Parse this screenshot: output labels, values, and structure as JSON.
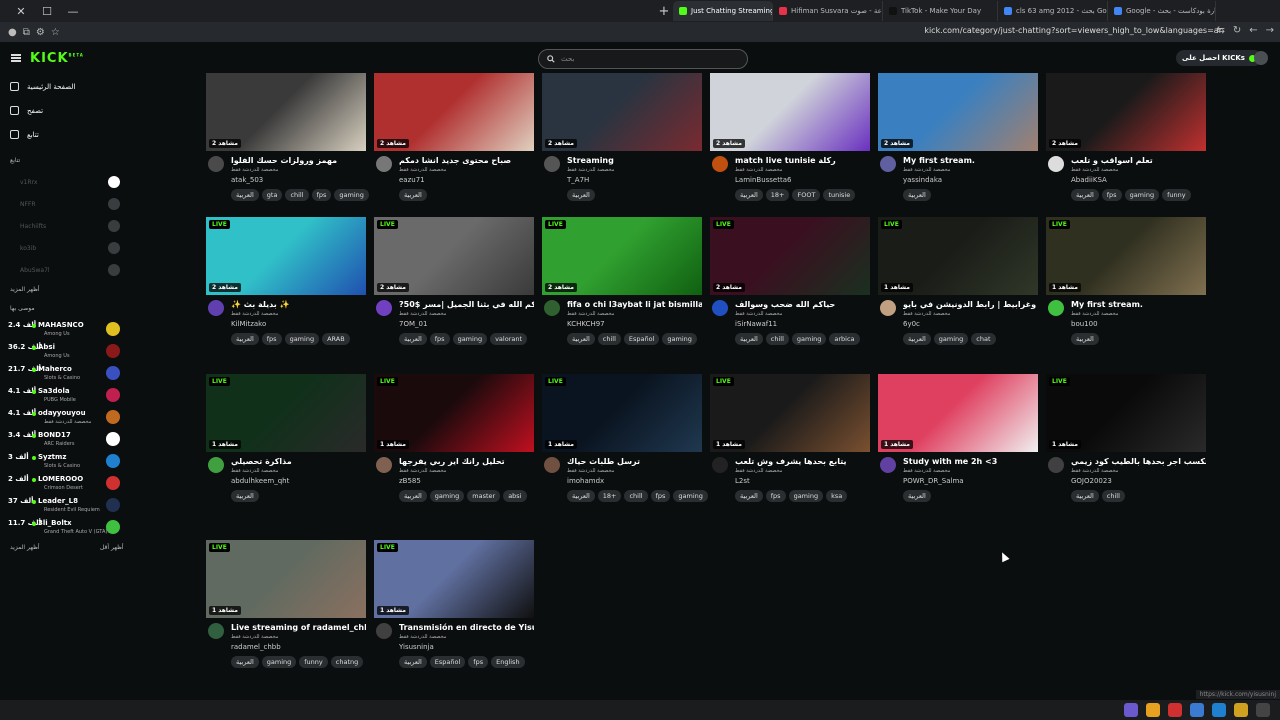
{
  "browser": {
    "tabs": [
      {
        "label": "Just Chatting Streaming - Live",
        "active": true,
        "color": "#53fc18"
      },
      {
        "label": "Hifiman Susvara سماعة - صوت",
        "active": false,
        "color": "#e8324a"
      },
      {
        "label": "TikTok - Make Your Day",
        "active": false,
        "color": "#111111"
      },
      {
        "label": "cls 63 amg 2012 - بحث Google",
        "active": false,
        "color": "#4285f4"
      },
      {
        "label": "Google - سيارة بودكاست - بحث",
        "active": false,
        "color": "#4285f4"
      }
    ],
    "url": "kick.com/category/just-chatting?sort=viewers_high_to_low&languages=ar"
  },
  "header": {
    "logo": "KICK",
    "logo_sup": "BETA",
    "search_placeholder": "بحث",
    "get_kicks": "احصل على KICKs"
  },
  "sidebar": {
    "nav": [
      {
        "label": "الصفحة الرئيسية",
        "icon": "home-icon"
      },
      {
        "label": "تصفح",
        "icon": "browse-icon"
      },
      {
        "label": "تتابع",
        "icon": "heart-icon"
      }
    ],
    "following_title": "تتابع",
    "following": [
      {
        "name": "v1Rrx"
      },
      {
        "name": "NFFR"
      },
      {
        "name": "Hachiifts"
      },
      {
        "name": "ko3ib"
      },
      {
        "name": "AbuSwa7l"
      }
    ],
    "show_more": "أظهر المزيد",
    "recommended_title": "موصى بها",
    "recommended": [
      {
        "name": "MAHASNCO",
        "game": "Among Us",
        "viewers": "2.4 ألف",
        "color": "#e0c020"
      },
      {
        "name": "Absi",
        "game": "Among Us",
        "viewers": "36.2 ألف",
        "color": "#8a1a1a"
      },
      {
        "name": "Maherco",
        "game": "Slots & Casino",
        "viewers": "21.7 ألف",
        "color": "#3a50c0"
      },
      {
        "name": "Sa3dola",
        "game": "PUBG Mobile",
        "viewers": "4.1 ألف",
        "color": "#c02050"
      },
      {
        "name": "odayyouyou",
        "game": "مخصصة للدردشة فقط",
        "viewers": "4.1 ألف",
        "color": "#c06a20"
      },
      {
        "name": "BOND17",
        "game": "ARC Raiders",
        "viewers": "3.4 ألف",
        "color": "#ffffff"
      },
      {
        "name": "Syztmz",
        "game": "Slots & Casino",
        "viewers": "3 ألف",
        "color": "#2080d0"
      },
      {
        "name": "LOMEROOO",
        "game": "Crimson Desert",
        "viewers": "2 ألف",
        "color": "#d03030"
      },
      {
        "name": "Leader_L8",
        "game": "Resident Evil Requiem",
        "viewers": "37 ألف",
        "color": "#203050"
      },
      {
        "name": "3li_Boltx",
        "game": "Grand Theft Auto V (GTA)...",
        "viewers": "11.7 ألف",
        "color": "#40c040"
      }
    ],
    "show_more2": "أظهر المزيد",
    "show_less": "أظهر أقل"
  },
  "cards": [
    {
      "title": "مهمز ورولزات حسك الفلوا",
      "sub": "مخصصة للدردشة فقط",
      "user": "atak_503",
      "viewers": "2 مشاهد",
      "live": false,
      "tags": [
        "العربية",
        "gta",
        "chill",
        "fps",
        "gaming"
      ],
      "thumb": "#3a3a3a",
      "thumb2": "#d8d0c0",
      "av": "#4a4a4a"
    },
    {
      "title": "صباح محتوى جديد انشا دمكم",
      "sub": "مخصصة للدردشة فقط",
      "user": "eazu71",
      "viewers": "2 مشاهد",
      "live": false,
      "tags": [
        "العربية"
      ],
      "thumb": "#b03030",
      "thumb2": "#e0d0c0",
      "av": "#777777"
    },
    {
      "title": "Streaming",
      "sub": "مخصصة للدردشة فقط",
      "user": "T_A7H",
      "viewers": "2 مشاهد",
      "live": false,
      "tags": [
        "العربية"
      ],
      "thumb": "#2a3440",
      "thumb2": "#7a2a30",
      "av": "#555555"
    },
    {
      "title": "match live tunisie ركلة",
      "sub": "مخصصة للدردشة فقط",
      "user": "LaminBussetta6",
      "viewers": "2 مشاهد",
      "live": false,
      "tags": [
        "العربية",
        "18+",
        "FOOT",
        "tunisie"
      ],
      "thumb": "#d0d4da",
      "thumb2": "#6a30c0",
      "av": "#c05010"
    },
    {
      "title": "My first stream.",
      "sub": "مخصصة للدردشة فقط",
      "user": "yassindaka",
      "viewers": "2 مشاهد",
      "live": false,
      "tags": [
        "العربية"
      ],
      "thumb": "#3a80c0",
      "thumb2": "#a08070",
      "av": "#6060a0"
    },
    {
      "title": "تعلم اسواقب و تلعب",
      "sub": "مخصصة للدردشة فقط",
      "user": "AbadiiKSA",
      "viewers": "2 مشاهد",
      "live": false,
      "tags": [
        "العربية",
        "fps",
        "gaming",
        "funny"
      ],
      "thumb": "#1a1a1a",
      "thumb2": "#c03030",
      "av": "#dddddd"
    },
    {
      "title": "✨ بديلة بث ✨",
      "sub": "مخصصة للدردشة فقط",
      "user": "KilMitzako",
      "viewers": "2 مشاهد",
      "live": true,
      "tags": [
        "العربية",
        "fps",
        "gaming",
        "ARAB"
      ],
      "thumb": "#30c0c8",
      "thumb2": "#2050b0",
      "av": "#6040b0"
    },
    {
      "title": "?50$ حياكم الله في بثنا الجميل |مسر",
      "sub": "مخصصة للدردشة فقط",
      "user": "7OM_01",
      "viewers": "2 مشاهد",
      "live": true,
      "tags": [
        "العربية",
        "fps",
        "gaming",
        "valorant"
      ],
      "thumb": "#6a6a6a",
      "thumb2": "#3a3a3a",
      "av": "#7040c0"
    },
    {
      "title": "fifa o chi l3aybat li jat bismillah",
      "sub": "مخصصة للدردشة فقط",
      "user": "KCHKCH97",
      "viewers": "2 مشاهد",
      "live": true,
      "tags": [
        "العربية",
        "chill",
        "Español",
        "gaming"
      ],
      "thumb": "#30a030",
      "thumb2": "#106010",
      "av": "#306030"
    },
    {
      "title": "حياكم الله ضحب وسوالف",
      "sub": "مخصصة للدردشة فقط",
      "user": "iSirNawaf11",
      "viewers": "2 مشاهد",
      "live": true,
      "tags": [
        "العربية",
        "chill",
        "gaming",
        "arbica"
      ],
      "thumb": "#3a1020",
      "thumb2": "#1a3020",
      "av": "#2050c0"
    },
    {
      "title": "بث تختيم وغرابيط | رابط الدونيشن في بايو",
      "sub": "مخصصة للدردشة فقط",
      "user": "6y0c",
      "viewers": "1 مشاهد",
      "live": true,
      "tags": [
        "العربية",
        "gaming",
        "chat"
      ],
      "thumb": "#1a1c18",
      "thumb2": "#303828",
      "av": "#c0a080"
    },
    {
      "title": "My first stream.",
      "sub": "مخصصة للدردشة فقط",
      "user": "bou100",
      "viewers": "1 مشاهد",
      "live": true,
      "tags": [
        "العربية"
      ],
      "thumb": "#303020",
      "thumb2": "#807050",
      "av": "#40c040"
    },
    {
      "title": "مذاكرة تحصيلي",
      "sub": "مخصصة للدردشة فقط",
      "user": "abdulhkeem_qht",
      "viewers": "1 مشاهد",
      "live": true,
      "tags": [
        "العربية"
      ],
      "thumb": "#10301a",
      "thumb2": "#2a2a2a",
      "av": "#40a040"
    },
    {
      "title": "تحليل رانك اير ربي يفرجها",
      "sub": "مخصصة للدردشة فقط",
      "user": "zB585",
      "viewers": "1 مشاهد",
      "live": true,
      "tags": [
        "العربية",
        "gaming",
        "master",
        "absi"
      ],
      "thumb": "#1a0a0c",
      "thumb2": "#c01020",
      "av": "#806050"
    },
    {
      "title": "ترسل طلبات حياك",
      "sub": "مخصصة للدردشة فقط",
      "user": "imohamdx",
      "viewers": "1 مشاهد",
      "live": true,
      "tags": [
        "العربية",
        "18+",
        "chill",
        "fps",
        "gaming"
      ],
      "thumb": "#0a1420",
      "thumb2": "#203850",
      "av": "#705040"
    },
    {
      "title": "يتابع بحدها يشرف وش تلعب",
      "sub": "مخصصة للدردشة فقط",
      "user": "L2st",
      "viewers": "1 مشاهد",
      "live": true,
      "tags": [
        "العربية",
        "fps",
        "gaming",
        "ksa"
      ],
      "thumb": "#1a1a1a",
      "thumb2": "#7a5030",
      "av": "#222222"
    },
    {
      "title": "Study with me 2h <3",
      "sub": "مخصصة للدردشة فقط",
      "user": "POWR_DR_Salma",
      "viewers": "1 مشاهد",
      "live": false,
      "tags": [
        "العربية"
      ],
      "thumb": "#e04060",
      "thumb2": "#f0f0f0",
      "av": "#6040a0"
    },
    {
      "title": "القران تكسب اجر بحدها بالطيب كود زيمي",
      "sub": "مخصصة للدردشة فقط",
      "user": "GOJO20023",
      "viewers": "1 مشاهد",
      "live": true,
      "tags": [
        "العربية",
        "chill"
      ],
      "thumb": "#0a0a0a",
      "thumb2": "#2a2a2a",
      "av": "#404040"
    },
    {
      "title": "Live streaming of radamel_chbb",
      "sub": "مخصصة للدردشة فقط",
      "user": "radamel_chbb",
      "viewers": "1 مشاهد",
      "live": true,
      "tags": [
        "العربية",
        "gaming",
        "funny",
        "chatng"
      ],
      "thumb": "#606a60",
      "thumb2": "#8a7060",
      "av": "#306040"
    },
    {
      "title": "Transmisión en directo de Yisu...",
      "sub": "مخصصة للدردشة فقط",
      "user": "Yisusninja",
      "viewers": "1 مشاهد",
      "live": true,
      "tags": [
        "العربية",
        "Español",
        "fps",
        "English"
      ],
      "thumb": "#6070a0",
      "thumb2": "#101010",
      "av": "#404040"
    }
  ],
  "status_url": "https://kick.com/yisusninj"
}
